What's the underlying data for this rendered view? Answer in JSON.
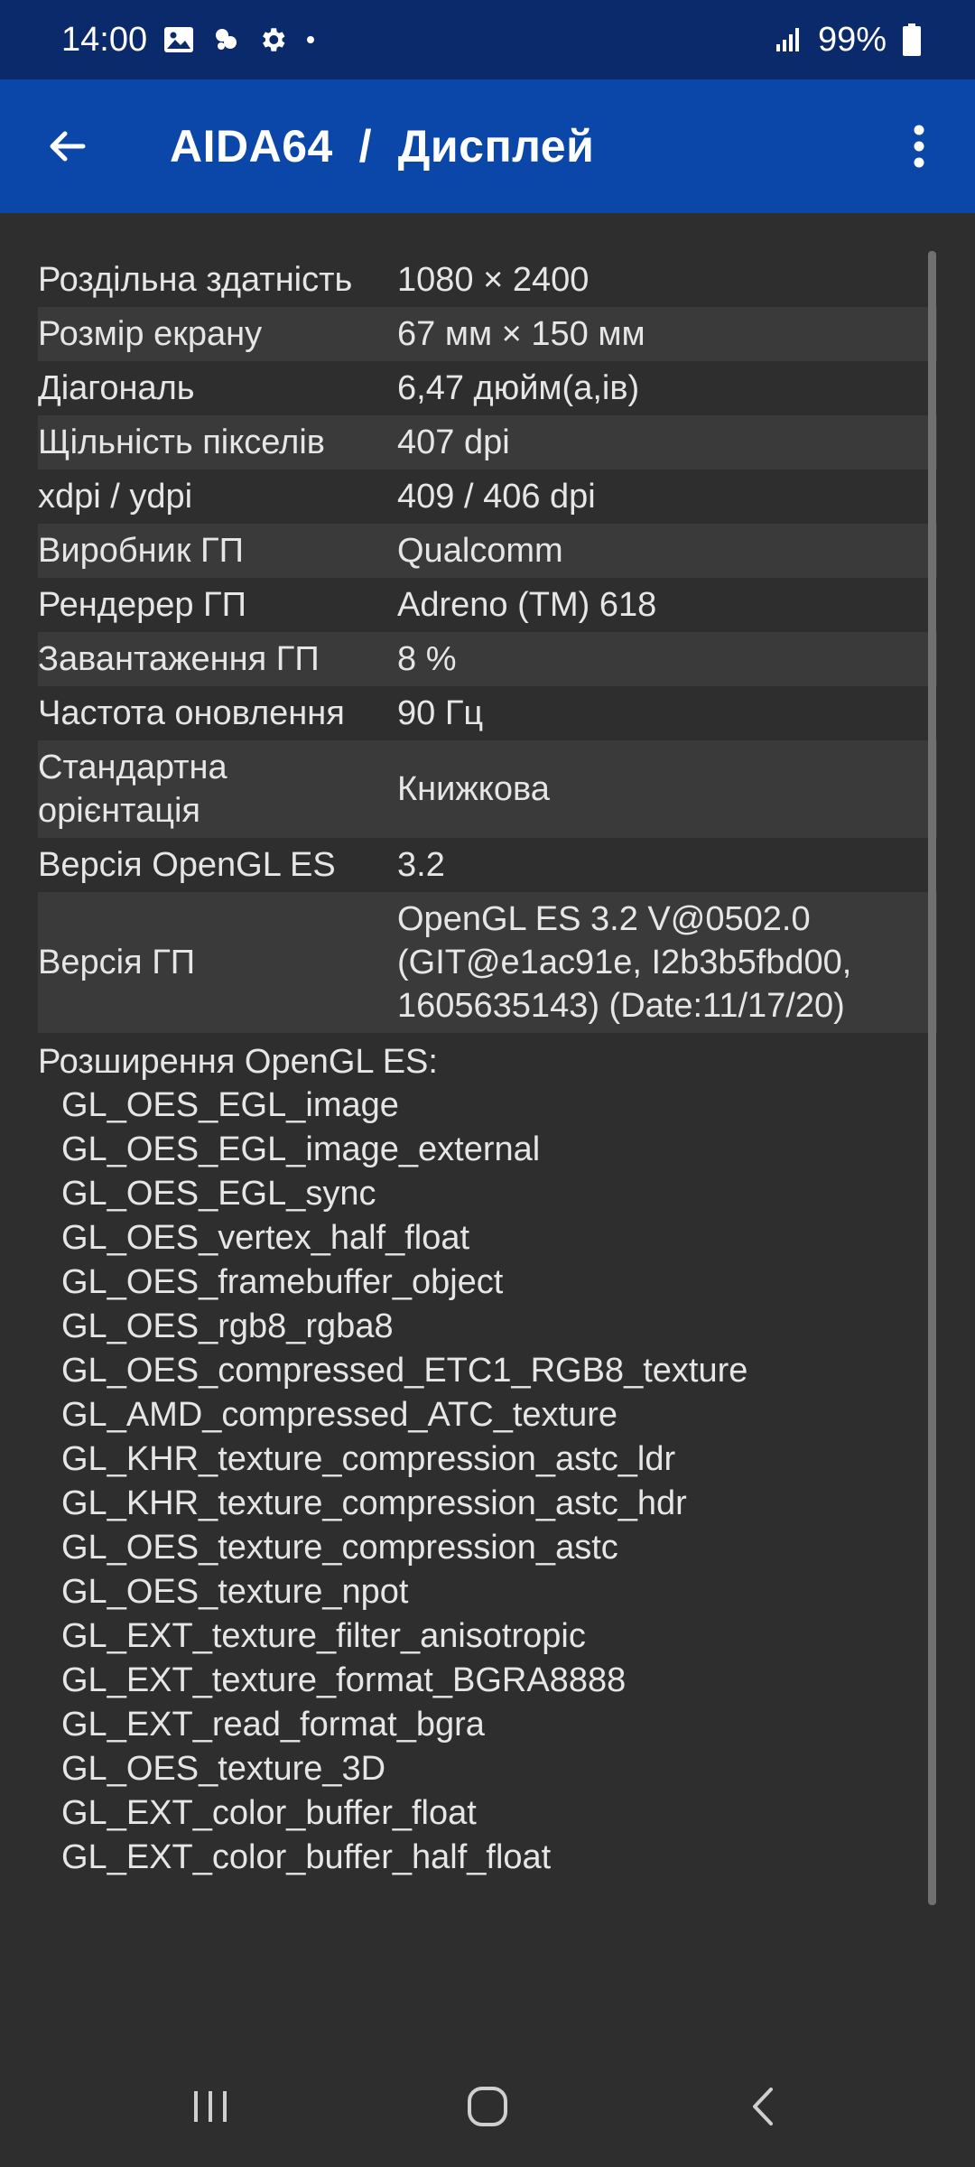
{
  "status_bar": {
    "time": "14:00",
    "battery": "99%",
    "icons": [
      "image-icon",
      "weather-icon",
      "gear-icon",
      "dot-icon",
      "signal-icon",
      "battery-icon"
    ]
  },
  "app_bar": {
    "title": "AIDA64  /  Дисплей",
    "back_icon": "arrow-left-icon",
    "menu_icon": "more-vert-icon"
  },
  "info": [
    {
      "label": "Роздільна здатність",
      "value": "1080 × 2400"
    },
    {
      "label": "Розмір екрану",
      "value": "67 мм × 150 мм"
    },
    {
      "label": "Діагональ",
      "value": "6,47 дюйм(а,ів)"
    },
    {
      "label": "Щільність пікселів",
      "value": "407 dpi"
    },
    {
      "label": "xdpi / ydpi",
      "value": "409 / 406 dpi"
    },
    {
      "label": "Виробник ГП",
      "value": "Qualcomm"
    },
    {
      "label": "Рендерер ГП",
      "value": "Adreno (TM) 618"
    },
    {
      "label": "Завантаження ГП",
      "value": "8 %"
    },
    {
      "label": "Частота оновлення",
      "value": "90 Гц"
    },
    {
      "label": "Стандартна орієнтація",
      "value": "Книжкова"
    },
    {
      "label": "Версія OpenGL ES",
      "value": "3.2"
    },
    {
      "label": "Версія ГП",
      "value": "OpenGL ES 3.2 V@0502.0 (GIT@e1ac91e, I2b3b5fbd00, 1605635143) (Date:11/17/20)"
    }
  ],
  "extensions_header": "Розширення OpenGL ES:",
  "extensions": [
    "GL_OES_EGL_image",
    "GL_OES_EGL_image_external",
    "GL_OES_EGL_sync",
    "GL_OES_vertex_half_float",
    "GL_OES_framebuffer_object",
    "GL_OES_rgb8_rgba8",
    "GL_OES_compressed_ETC1_RGB8_texture",
    "GL_AMD_compressed_ATC_texture",
    "GL_KHR_texture_compression_astc_ldr",
    "GL_KHR_texture_compression_astc_hdr",
    "GL_OES_texture_compression_astc",
    "GL_OES_texture_npot",
    "GL_EXT_texture_filter_anisotropic",
    "GL_EXT_texture_format_BGRA8888",
    "GL_EXT_read_format_bgra",
    "GL_OES_texture_3D",
    "GL_EXT_color_buffer_float",
    "GL_EXT_color_buffer_half_float"
  ],
  "nav_bar": {
    "icons": [
      "recents-icon",
      "home-icon",
      "back-nav-icon"
    ]
  },
  "colors": {
    "status_bar": "#0a2a6b",
    "app_bar": "#0b47a8",
    "background": "#2e2e2e",
    "row_alt": "#3a3a3a",
    "text": "#e6e6e6"
  }
}
